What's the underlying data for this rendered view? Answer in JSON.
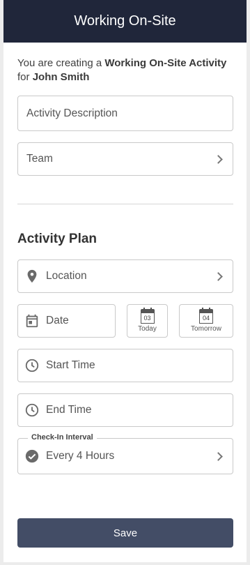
{
  "header": {
    "title": "Working On-Site"
  },
  "intro": {
    "prefix": "You are creating a ",
    "activity": "Working On-Site Activity",
    "for_text": "for ",
    "person": "John Smith"
  },
  "fields": {
    "activity_description_placeholder": "Activity Description",
    "team_label": "Team"
  },
  "plan": {
    "section_title": "Activity Plan",
    "location_label": "Location",
    "date_label": "Date",
    "today": {
      "day": "03",
      "label": "Today"
    },
    "tomorrow": {
      "day": "04",
      "label": "Tomorrow"
    },
    "start_time_label": "Start Time",
    "end_time_label": "End Time",
    "checkin": {
      "legend": "Check-In Interval",
      "value": "Every 4 Hours"
    }
  },
  "actions": {
    "save_label": "Save"
  },
  "colors": {
    "header_bg": "#20263a",
    "save_bg": "#434d66",
    "border": "#c9c9c9"
  }
}
